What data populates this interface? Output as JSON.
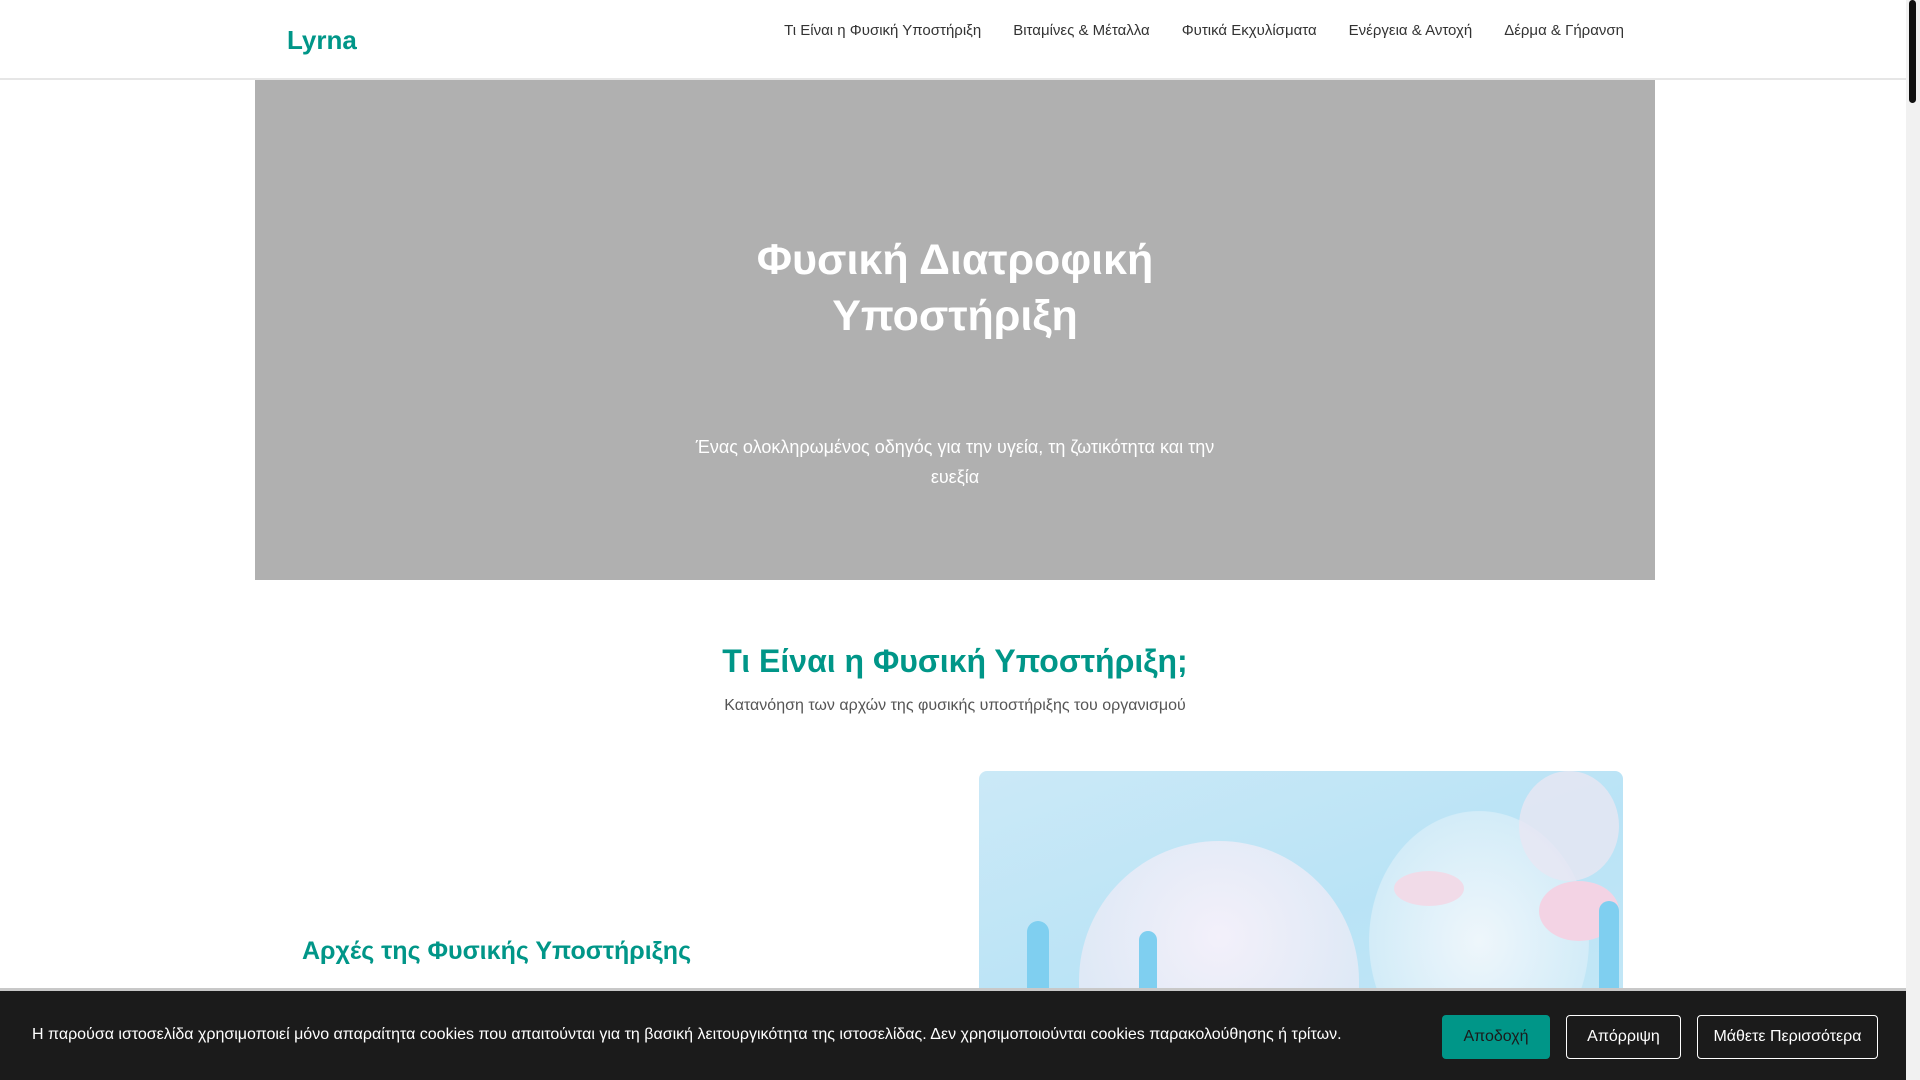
{
  "header": {
    "logo": "Lyrna",
    "nav": [
      "Τι Είναι η Φυσική Υποστήριξη",
      "Βιταμίνες & Μέταλλα",
      "Φυτικά Εκχυλίσματα",
      "Ενέργεια & Αντοχή",
      "Δέρμα & Γήρανση"
    ]
  },
  "hero": {
    "title": "Φυσική Διατροφική Υποστήριξη",
    "subtitle": "Ένας ολοκληρωμένος οδηγός για την υγεία, τη ζωτικότητα και την ευεξία"
  },
  "section": {
    "title": "Τι Είναι η Φυσική Υποστήριξη;",
    "subtitle": "Κατανόηση των αρχών της φυσικής υποστήριξης του οργανισμού",
    "h3": "Αρχές της Φυσικής Υποστήριξης"
  },
  "cookie": {
    "text": "Η παρούσα ιστοσελίδα χρησιμοποιεί μόνο απαραίτητα cookies που απαιτούνται για τη βασική λειτουργικότητα της ιστοσελίδας. Δεν χρησιμοποιούνται cookies παρακολούθησης ή τρίτων.",
    "accept": "Αποδοχή",
    "reject": "Απόρριψη",
    "learn": "Μάθετε Περισσότερα"
  },
  "colors": {
    "accent": "#009688",
    "cookie_bg": "#1b1b1b",
    "hero_bg": "#b0b0b0"
  }
}
